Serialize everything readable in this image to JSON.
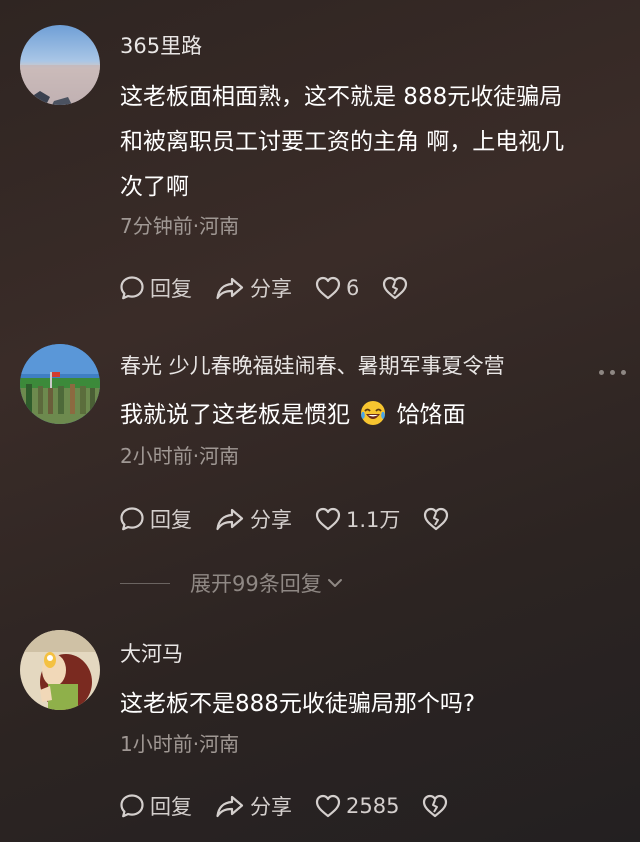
{
  "comments": [
    {
      "username": "365里路",
      "text_lines": [
        "这老板面相面熟，这不就是 888元收徒骗局",
        "和被离职员工讨要工资的主角 啊，上电视几",
        "次了啊"
      ],
      "meta": "7分钟前·河南",
      "reply_label": "回复",
      "share_label": "分享",
      "like_count": "6"
    },
    {
      "username": "春光 少儿春晚福娃闹春、暑期军事夏令营",
      "text_before_emoji": "我就说了这老板是惯犯",
      "emoji": "laughing-crying-emoji",
      "text_after_emoji": "饸饹面",
      "meta": "2小时前·河南",
      "reply_label": "回复",
      "share_label": "分享",
      "like_count": "1.1万"
    },
    {
      "username": "大河马",
      "text": "这老板不是888元收徒骗局那个吗?",
      "meta": "1小时前·河南",
      "reply_label": "回复",
      "share_label": "分享",
      "like_count": "2585"
    }
  ],
  "expand_replies": {
    "label": "展开99条回复"
  },
  "icons": [
    "comment-bubble-icon",
    "share-arrow-icon",
    "heart-icon",
    "broken-heart-icon",
    "chevron-down-icon",
    "more-dots-icon"
  ]
}
